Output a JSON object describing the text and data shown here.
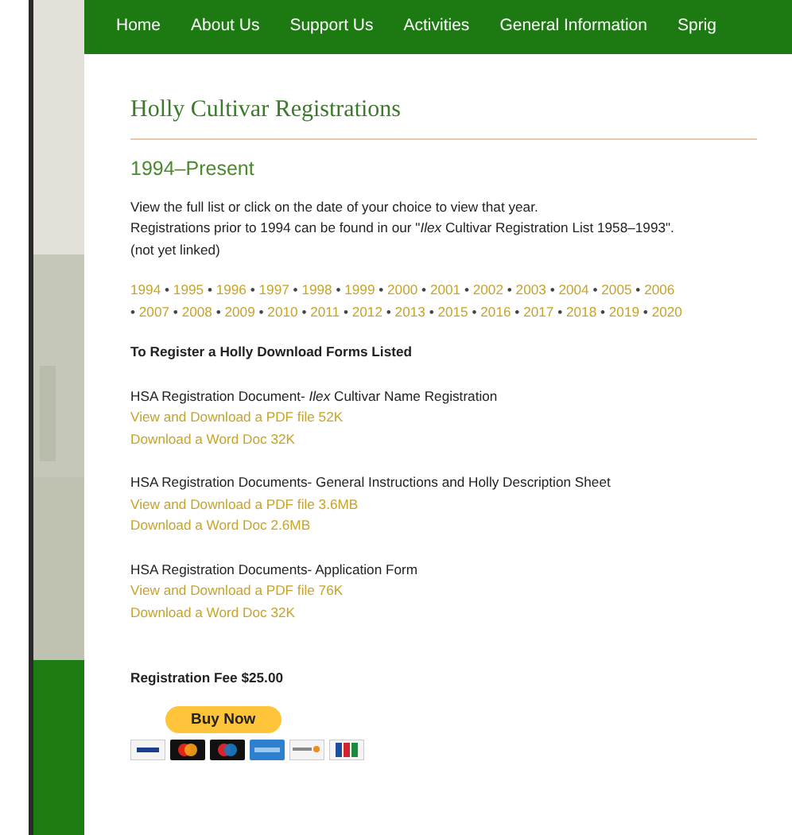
{
  "nav": {
    "items": [
      "Home",
      "About Us",
      "Support Us",
      "Activities",
      "General Information",
      "Sprig"
    ]
  },
  "title": "Holly Cultivar Registrations",
  "subtitle": "1994–Present",
  "intro": [
    "View the full list or click on the date of your choice to view that year.",
    "Registrations prior to 1994 can be found in our \"*Ilex* Cultivar Registration List 1958–1993\".",
    "(not yet linked)"
  ],
  "years": {
    "separator": "•",
    "items": [
      "1994",
      "1995",
      "1996",
      "1997",
      "1998",
      "1999",
      "2000",
      "2001",
      "2002",
      "2003",
      "2004",
      "2005",
      "2006",
      "2007",
      "2008",
      "2009",
      "2010",
      "2011",
      "2012",
      "2013",
      "2015",
      "2016",
      "2017",
      "2018",
      "2019",
      "2020"
    ]
  },
  "forms_heading": "To Register a Holly Download Forms Listed",
  "documents": [
    {
      "title": "HSA Registration Document- *Ilex* Cultivar Name Registration",
      "links": [
        "View and Download a PDF file 52K",
        "Download a Word Doc 32K"
      ]
    },
    {
      "title": "HSA Registration Documents- General Instructions and Holly Description Sheet",
      "links": [
        "View and Download a PDF file 3.6MB",
        "Download a Word Doc 2.6MB"
      ]
    },
    {
      "title": "HSA Registration Documents- Application Form",
      "links": [
        "View and Download a PDF file 76K",
        "Download a Word Doc 32K"
      ]
    }
  ],
  "fee": "Registration Fee $25.00",
  "buy_button": "Buy Now",
  "cards": [
    {
      "kind": "visa"
    },
    {
      "kind": "mastercard"
    },
    {
      "kind": "maestro"
    },
    {
      "kind": "amex"
    },
    {
      "kind": "discover"
    },
    {
      "kind": "jcb"
    }
  ]
}
